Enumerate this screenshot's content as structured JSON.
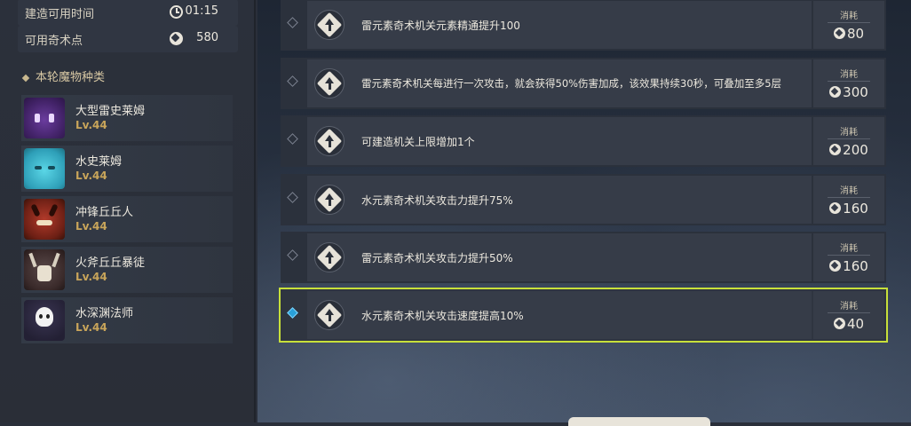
{
  "stats": {
    "build_time_label": "建造可用时间",
    "build_time_value": "01:15",
    "points_label": "可用奇术点",
    "points_value": "580"
  },
  "monsters": {
    "section_title": "本轮魔物种类",
    "items": [
      {
        "name": "大型雷史莱姆",
        "level": "Lv.44",
        "portrait": "electro-slime"
      },
      {
        "name": "水史莱姆",
        "level": "Lv.44",
        "portrait": "hydro-slime"
      },
      {
        "name": "冲锋丘丘人",
        "level": "Lv.44",
        "portrait": "hilichurl-fighter"
      },
      {
        "name": "火斧丘丘暴徒",
        "level": "Lv.44",
        "portrait": "mitachurl"
      },
      {
        "name": "水深渊法师",
        "level": "Lv.44",
        "portrait": "hydro-abyss-mage"
      }
    ]
  },
  "skills": {
    "cost_label": "消耗",
    "items": [
      {
        "text": "雷元素奇术机关元素精通提升100",
        "cost": "80",
        "selected": false
      },
      {
        "text": "雷元素奇术机关每进行一次攻击，就会获得50%伤害加成，该效果持续30秒，可叠加至多5层",
        "cost": "300",
        "selected": false
      },
      {
        "text": "可建造机关上限增加1个",
        "cost": "200",
        "selected": false
      },
      {
        "text": "水元素奇术机关攻击力提升75%",
        "cost": "160",
        "selected": false
      },
      {
        "text": "雷元素奇术机关攻击力提升50%",
        "cost": "160",
        "selected": false
      },
      {
        "text": "水元素奇术机关攻击速度提高10%",
        "cost": "40",
        "selected": true
      }
    ]
  },
  "colors": {
    "selected_outline": "#c8e03a",
    "level_text": "#c9a55a",
    "selected_check": "#2aa0d8"
  }
}
